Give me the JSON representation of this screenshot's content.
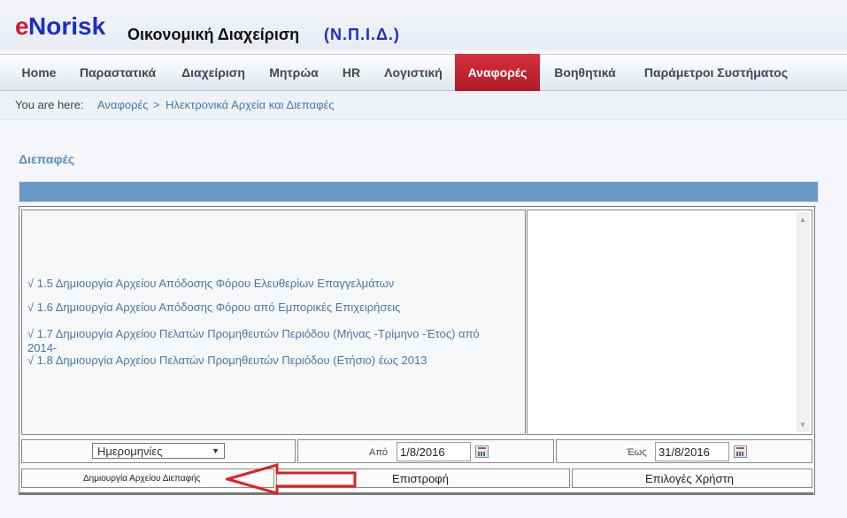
{
  "header": {
    "brand_e": "e",
    "brand_rest": "Norisk",
    "app_title": "Οικονομική Διαχείριση",
    "app_subtitle": "(Ν.Π.Ι.Δ.)"
  },
  "nav": {
    "items": [
      {
        "label": "Home"
      },
      {
        "label": "Παραστατικά"
      },
      {
        "label": "Διαχείριση"
      },
      {
        "label": "Μητρώα"
      },
      {
        "label": "HR"
      },
      {
        "label": "Λογιστική"
      },
      {
        "label": "Αναφορές",
        "active": true
      },
      {
        "label": "Βοηθητικά"
      },
      {
        "label": "Παράμετροι Συστήματος"
      }
    ],
    "active_color": "#c0222e"
  },
  "breadcrumb": {
    "label": "You are here:",
    "link1": "Αναφορές",
    "separator": ">",
    "link2": "Ηλεκτρονικά Αρχεία και Διεπαφές"
  },
  "main": {
    "section_title": "Διεπαφές",
    "menu_items": [
      "√ 1.5 Δημιουργία Αρχείου Απόδοσης Φόρου Ελευθερίων Επαγγελμάτων",
      "√ 1.6 Δημιουργία Αρχείου Απόδοσης Φόρου από Εμπορικές Επιχειρήσεις",
      "√ 1.7 Δημιουργία Αρχείου Πελατών Προμηθευτών Περιόδου (Μήνας -Τρίμηνο -Έτος) από 2014-",
      "√ 1.8 Δημιουργία Αρχείου Πελατών Προμηθευτών Περιόδου (Ετήσιο) έως 2013"
    ],
    "filter": {
      "select_value": "Ημερομηνίες",
      "from_label": "Από",
      "from_value": "1/8/2016",
      "to_label": "Έως",
      "to_value": "31/8/2016"
    },
    "actions": {
      "create_label": "Δημιουργία Αρχείου Διεπαφής",
      "back_label": "Επιστροφή",
      "user_options_label": "Επιλογές Χρήστη"
    }
  },
  "colors": {
    "band": "#6a99c8",
    "link": "#4a78a8",
    "annotation_arrow": "#e02020"
  }
}
